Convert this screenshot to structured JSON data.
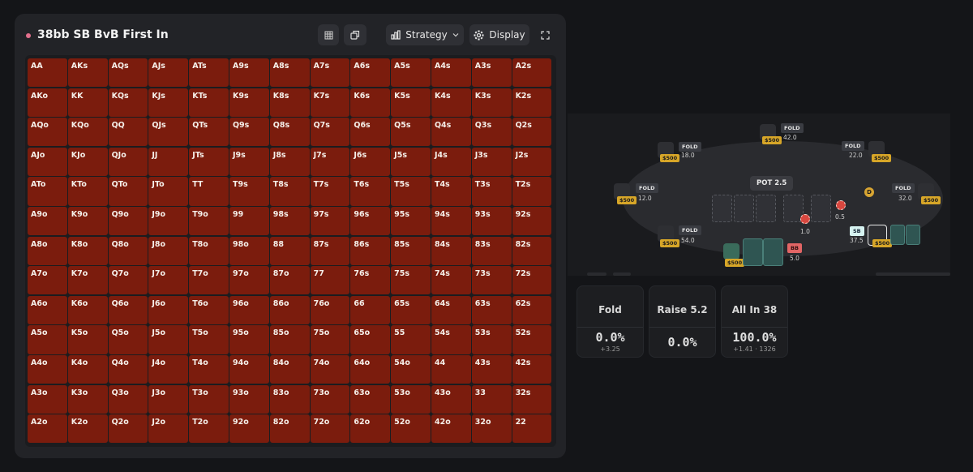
{
  "header": {
    "title": "38bb SB BvB First In",
    "strategy_label": "Strategy",
    "display_label": "Display"
  },
  "grid": {
    "rows": [
      [
        "AA",
        "AKs",
        "AQs",
        "AJs",
        "ATs",
        "A9s",
        "A8s",
        "A7s",
        "A6s",
        "A5s",
        "A4s",
        "A3s",
        "A2s"
      ],
      [
        "AKo",
        "KK",
        "KQs",
        "KJs",
        "KTs",
        "K9s",
        "K8s",
        "K7s",
        "K6s",
        "K5s",
        "K4s",
        "K3s",
        "K2s"
      ],
      [
        "AQo",
        "KQo",
        "QQ",
        "QJs",
        "QTs",
        "Q9s",
        "Q8s",
        "Q7s",
        "Q6s",
        "Q5s",
        "Q4s",
        "Q3s",
        "Q2s"
      ],
      [
        "AJo",
        "KJo",
        "QJo",
        "JJ",
        "JTs",
        "J9s",
        "J8s",
        "J7s",
        "J6s",
        "J5s",
        "J4s",
        "J3s",
        "J2s"
      ],
      [
        "ATo",
        "KTo",
        "QTo",
        "JTo",
        "TT",
        "T9s",
        "T8s",
        "T7s",
        "T6s",
        "T5s",
        "T4s",
        "T3s",
        "T2s"
      ],
      [
        "A9o",
        "K9o",
        "Q9o",
        "J9o",
        "T9o",
        "99",
        "98s",
        "97s",
        "96s",
        "95s",
        "94s",
        "93s",
        "92s"
      ],
      [
        "A8o",
        "K8o",
        "Q8o",
        "J8o",
        "T8o",
        "98o",
        "88",
        "87s",
        "86s",
        "85s",
        "84s",
        "83s",
        "82s"
      ],
      [
        "A7o",
        "K7o",
        "Q7o",
        "J7o",
        "T7o",
        "97o",
        "87o",
        "77",
        "76s",
        "75s",
        "74s",
        "73s",
        "72s"
      ],
      [
        "A6o",
        "K6o",
        "Q6o",
        "J6o",
        "T6o",
        "96o",
        "86o",
        "76o",
        "66",
        "65s",
        "64s",
        "63s",
        "62s"
      ],
      [
        "A5o",
        "K5o",
        "Q5o",
        "J5o",
        "T5o",
        "95o",
        "85o",
        "75o",
        "65o",
        "55",
        "54s",
        "53s",
        "52s"
      ],
      [
        "A4o",
        "K4o",
        "Q4o",
        "J4o",
        "T4o",
        "94o",
        "84o",
        "74o",
        "64o",
        "54o",
        "44",
        "43s",
        "42s"
      ],
      [
        "A3o",
        "K3o",
        "Q3o",
        "J3o",
        "T3o",
        "93o",
        "83o",
        "73o",
        "63o",
        "53o",
        "43o",
        "33",
        "32s"
      ],
      [
        "A2o",
        "K2o",
        "Q2o",
        "J2o",
        "T2o",
        "92o",
        "82o",
        "72o",
        "62o",
        "52o",
        "42o",
        "32o",
        "22"
      ]
    ],
    "cell_color": "#7b1c0d"
  },
  "table": {
    "pot": "POT 2.5",
    "fold_label": "FOLD",
    "stack_label": "$500",
    "seats": {
      "top_left": {
        "amount": "18.0"
      },
      "top": {
        "amount": "42.0"
      },
      "top_right": {
        "amount": "22.0"
      },
      "left": {
        "amount": "12.0"
      },
      "right": {
        "amount": "32.0"
      },
      "bottom_left": {
        "amount": "54.0"
      },
      "sb": {
        "tag": "SB",
        "amount": "37.5",
        "bet": "0.5"
      },
      "bb": {
        "tag": "BB",
        "amount": "5.0",
        "bet": "1.0"
      }
    },
    "dealer": "D"
  },
  "actions": [
    {
      "label": "Fold",
      "pct": "0.0%",
      "sub": "+3.25"
    },
    {
      "label": "Raise 5.2",
      "pct": "0.0%",
      "sub": ""
    },
    {
      "label": "All In 38",
      "pct": "100.0%",
      "sub": "+1.41 · 1326"
    }
  ]
}
